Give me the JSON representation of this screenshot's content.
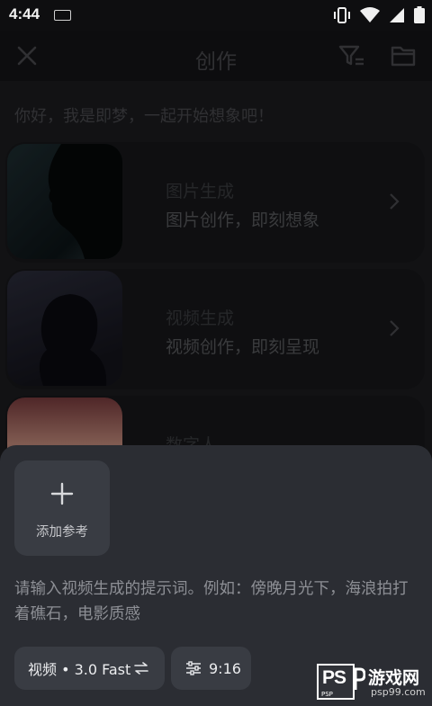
{
  "status_bar": {
    "time": "4:44"
  },
  "header": {
    "title": "创作"
  },
  "greeting": "你好，我是即梦，一起开始想象吧！",
  "cards": [
    {
      "title": "图片生成",
      "subtitle": "图片创作，即刻想象"
    },
    {
      "title": "视频生成",
      "subtitle": "视频创作，即刻呈现"
    },
    {
      "title": "数字人",
      "subtitle": ""
    }
  ],
  "sheet": {
    "add_reference_label": "添加参考",
    "prompt_placeholder": "请输入视频生成的提示词。例如：傍晚月光下，海浪拍打着礁石，电影质感",
    "model_chip": "视频 • 3.0 Fast",
    "ratio_chip": "9:16"
  },
  "watermark": {
    "logo": "PS",
    "logo_sub": "PSP",
    "site_name": "游戏网",
    "url": "psp99.com"
  },
  "colors": {
    "sheet_bg": "#2b2d33",
    "chip_bg": "#393c43",
    "page_bg": "#1c1d20"
  }
}
